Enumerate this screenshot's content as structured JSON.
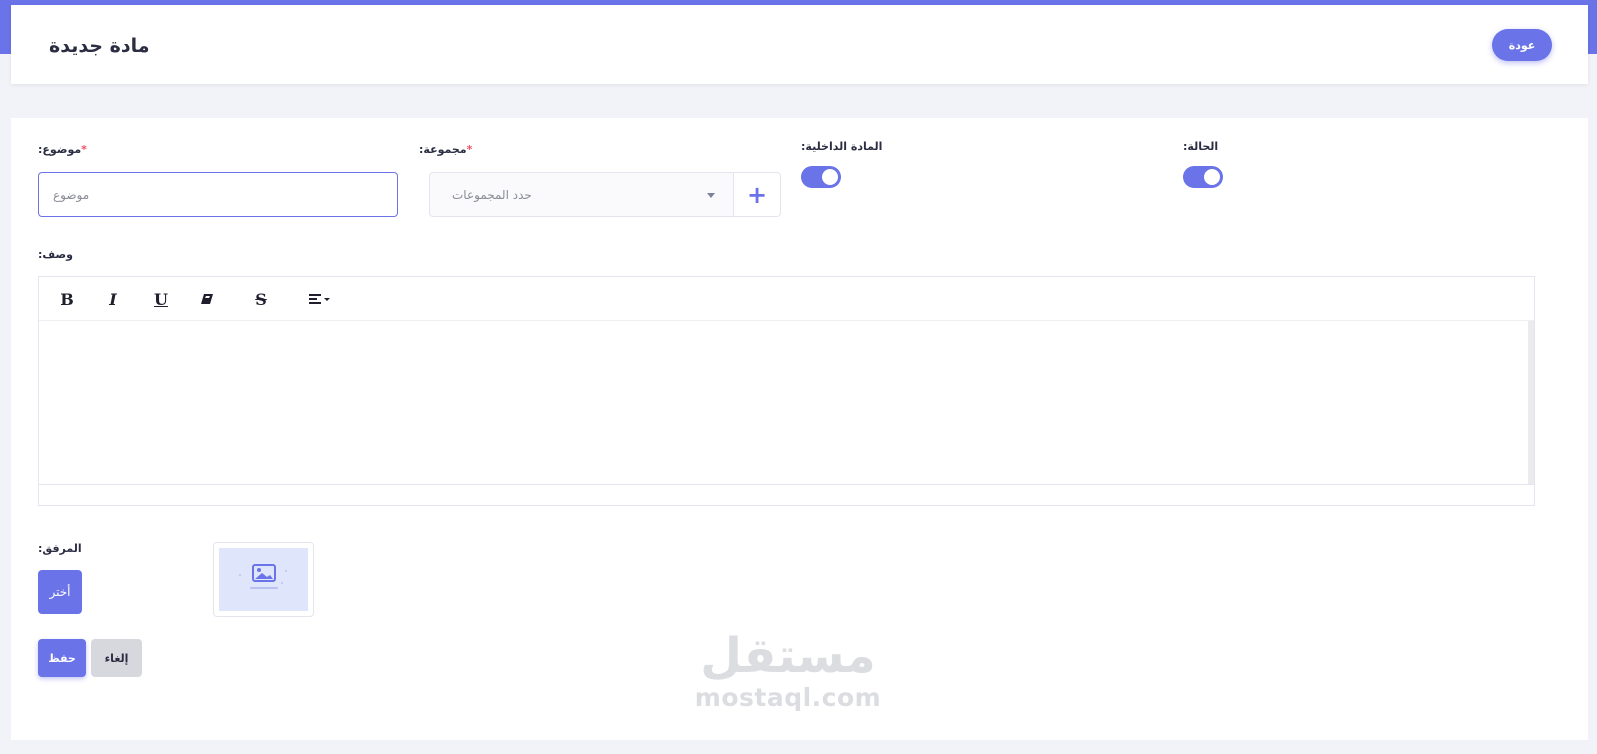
{
  "header": {
    "title": "مادة جديدة",
    "back_label": "عودة"
  },
  "form": {
    "subject": {
      "label": ":موضوع",
      "required_mark": "*",
      "placeholder": "موضوع",
      "value": ""
    },
    "group": {
      "label": ":مجموعة",
      "required_mark": "*",
      "placeholder": "حدد المجموعات",
      "add_label": "+"
    },
    "internal_material": {
      "label": ":المادة الداخلية",
      "enabled": true
    },
    "status": {
      "label": ":الحالة",
      "enabled": true
    },
    "description": {
      "label": ":وصف",
      "toolbar": [
        {
          "name": "bold",
          "glyph": "B"
        },
        {
          "name": "italic",
          "glyph": "I"
        },
        {
          "name": "underline",
          "glyph": "U"
        },
        {
          "name": "eraser",
          "glyph": "⌫"
        },
        {
          "name": "strikethrough",
          "glyph": "S"
        },
        {
          "name": "align",
          "glyph": "≡"
        }
      ]
    },
    "attachment": {
      "label": ":المرفق",
      "choose_label": "أختر"
    },
    "actions": {
      "save_label": "حفظ",
      "cancel_label": "إلغاء"
    }
  },
  "watermark": {
    "arabic": "مستقل",
    "latin": "mostaql.com"
  },
  "colors": {
    "accent": "#6a73e8",
    "required": "#f64e60",
    "background": "#f2f3f8"
  }
}
